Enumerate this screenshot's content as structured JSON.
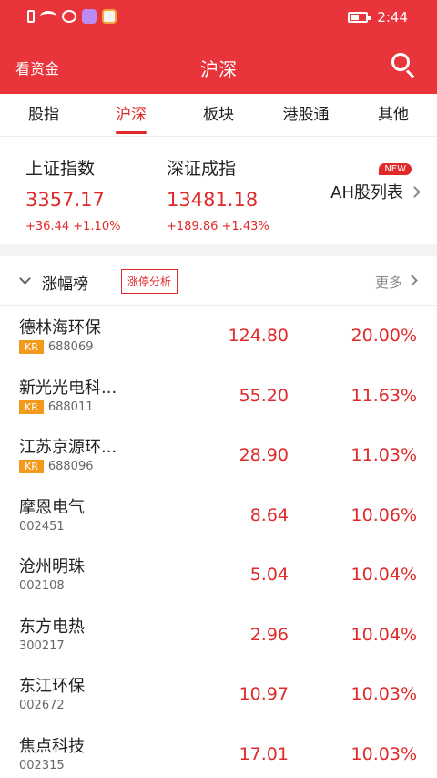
{
  "status_bar": {
    "time": "2:44"
  },
  "header": {
    "left_label": "看资金",
    "title": "沪深"
  },
  "tabs": [
    {
      "label": "股指"
    },
    {
      "label": "沪深"
    },
    {
      "label": "板块"
    },
    {
      "label": "港股通"
    },
    {
      "label": "其他"
    }
  ],
  "indexes": [
    {
      "name": "上证指数",
      "value": "3357.17",
      "change": "+36.44",
      "pct": "+1.10%"
    },
    {
      "name": "深证成指",
      "value": "13481.18",
      "change": "+189.86",
      "pct": "+1.43%"
    }
  ],
  "ah": {
    "label": "AH股列表",
    "badge": "NEW"
  },
  "section": {
    "title": "涨幅榜",
    "button": "涨停分析",
    "more": "更多"
  },
  "stocks": [
    {
      "name": "德林海环保",
      "badge": "KR",
      "code": "688069",
      "price": "124.80",
      "pct": "20.00%"
    },
    {
      "name": "新光光电科...",
      "badge": "KR",
      "code": "688011",
      "price": "55.20",
      "pct": "11.63%"
    },
    {
      "name": "江苏京源环...",
      "badge": "KR",
      "code": "688096",
      "price": "28.90",
      "pct": "11.03%"
    },
    {
      "name": "摩恩电气",
      "badge": "",
      "code": "002451",
      "price": "8.64",
      "pct": "10.06%"
    },
    {
      "name": "沧州明珠",
      "badge": "",
      "code": "002108",
      "price": "5.04",
      "pct": "10.04%"
    },
    {
      "name": "东方电热",
      "badge": "",
      "code": "300217",
      "price": "2.96",
      "pct": "10.04%"
    },
    {
      "name": "东江环保",
      "badge": "",
      "code": "002672",
      "price": "10.97",
      "pct": "10.03%"
    },
    {
      "name": "焦点科技",
      "badge": "",
      "code": "002315",
      "price": "17.01",
      "pct": "10.03%"
    }
  ],
  "colors": {
    "brand": "#e9343b",
    "up": "#e02a2a",
    "badge": "#f29a1c"
  }
}
